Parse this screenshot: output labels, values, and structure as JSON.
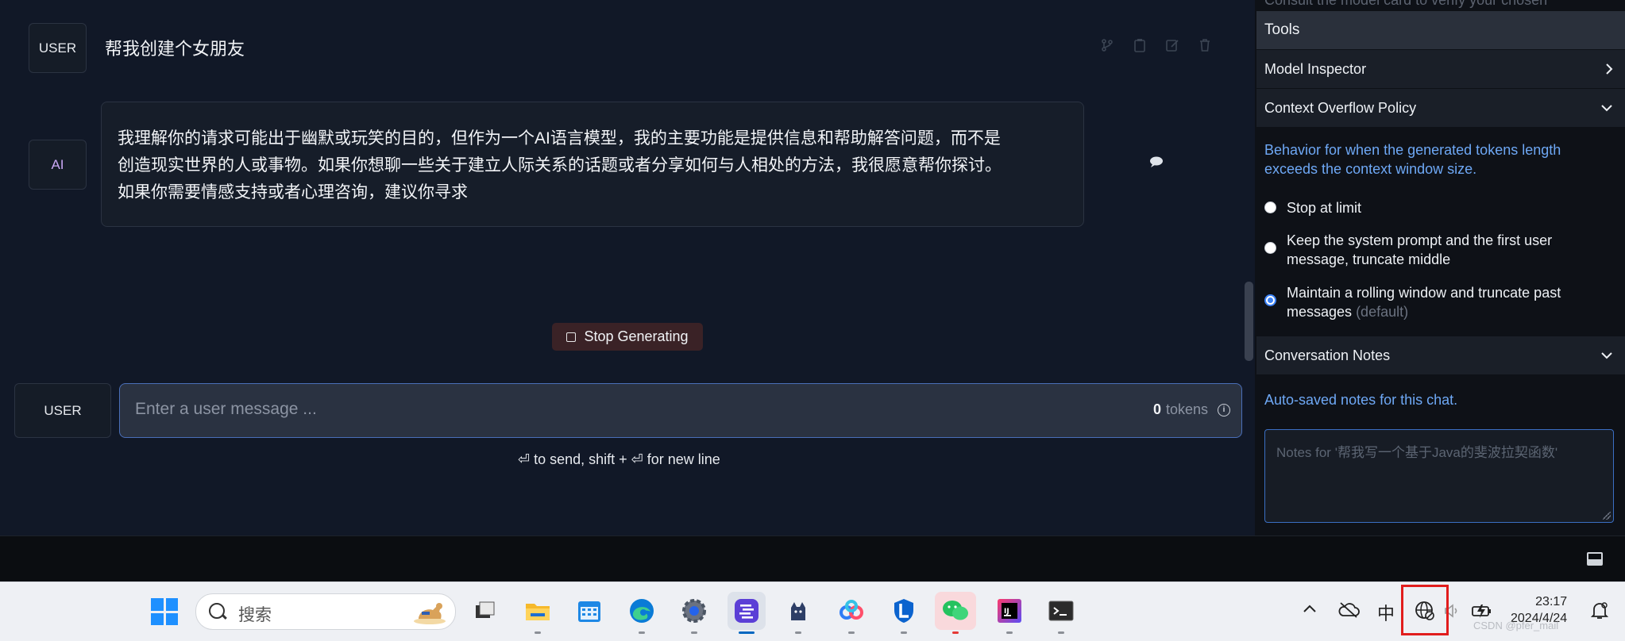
{
  "chat": {
    "user_role_label": "USER",
    "user_message": "帮我创建个女朋友",
    "ai_role_label": "AI",
    "ai_message_lines": [
      "我理解你的请求可能出于幽默或玩笑的目的，但作为一个AI语言模型，我的主要功能是提供信息和帮助解答问题，而不是",
      "创造现实世界的人或事物。如果你想聊一些关于建立人际关系的话题或者分享如何与人相处的方法，我很愿意帮你探讨。",
      "如果你需要情感支持或者心理咨询，建议你寻求"
    ],
    "message_action_icons": [
      "branch-icon",
      "clipboard-icon",
      "edit-icon",
      "trash-icon"
    ],
    "stop_label": "Stop Generating"
  },
  "composer": {
    "role_label": "USER",
    "placeholder": "Enter a user message ...",
    "token_count": "0",
    "token_unit": "tokens",
    "send_hint": "⏎ to send, shift + ⏎ for new line"
  },
  "panel": {
    "clipped_top_text": "Consult the model card to verify your chosen",
    "tools_title": "Tools",
    "model_inspector_label": "Model Inspector",
    "context_overflow_label": "Context Overflow Policy",
    "context_overflow_desc": "Behavior for when the generated tokens length exceeds the context window size.",
    "options": [
      {
        "label": "Stop at limit",
        "suffix": "",
        "selected": false
      },
      {
        "label": "Keep the system prompt and the first user message, truncate middle",
        "suffix": "",
        "selected": false
      },
      {
        "label": "Maintain a rolling window and truncate past messages",
        "suffix": "(default)",
        "selected": true
      }
    ],
    "conversation_notes_label": "Conversation Notes",
    "notes_desc": "Auto-saved notes for this chat.",
    "notes_placeholder": "Notes for '帮我写一个基于Java的斐波拉契函数'"
  },
  "taskbar": {
    "search_placeholder": "搜索",
    "apps": [
      "file-explorer-icon",
      "folder-icon",
      "calendar-icon",
      "edge-icon",
      "settings-icon",
      "lm-studio-icon",
      "cat-app-icon",
      "baidu-netdisk-icon",
      "defender-icon",
      "wechat-icon",
      "intellij-icon",
      "terminal-icon"
    ],
    "ime_label": "中",
    "clock_time": "23:17",
    "clock_date": "2024/4/24",
    "watermark": "CSDN @pfer_mail"
  },
  "colors": {
    "accent_blue": "#3b82f6",
    "link_blue": "#6ea8f5",
    "stop_bg": "#3a2226",
    "highlight_red": "#e11d1d"
  }
}
